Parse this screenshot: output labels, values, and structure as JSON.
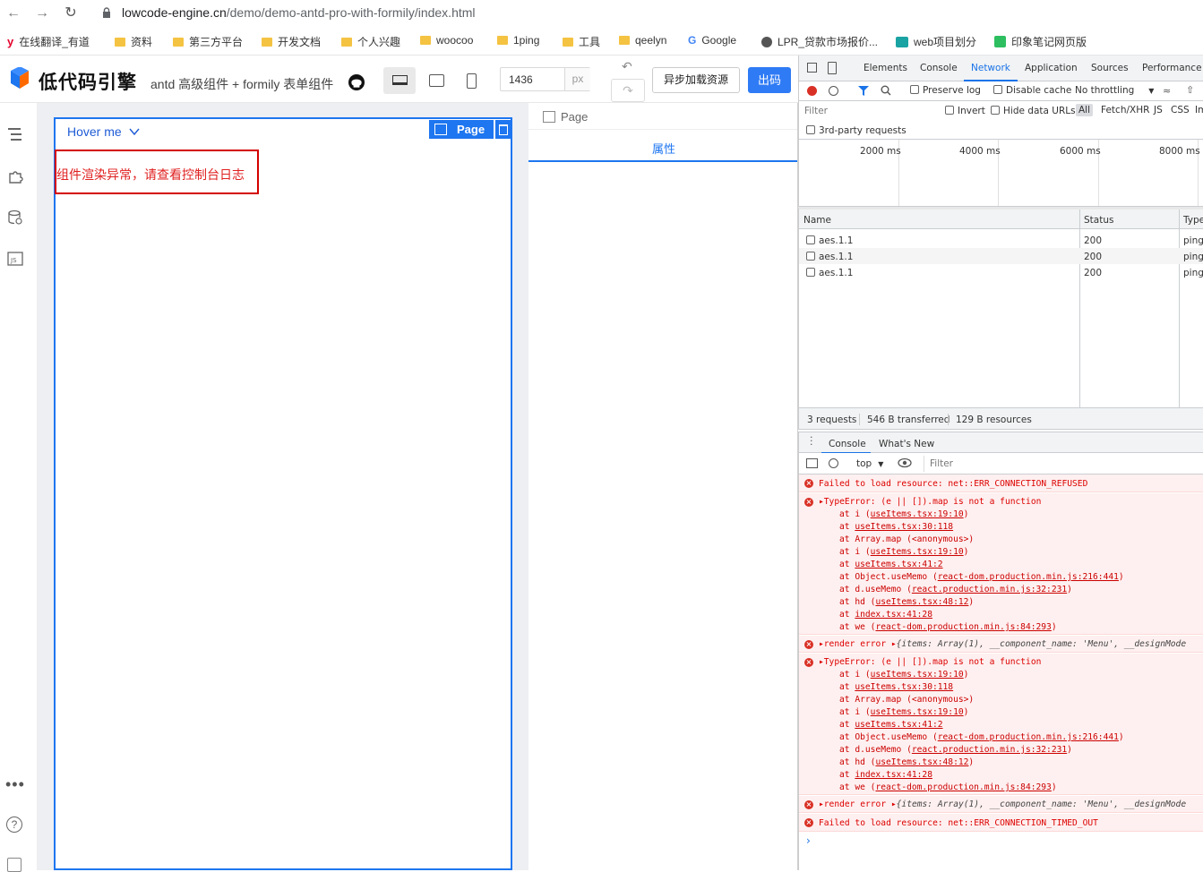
{
  "browser": {
    "url_host": "lowcode-engine.cn",
    "url_path": "/demo/demo-antd-pro-with-formily/index.html",
    "bookmarks": [
      {
        "label": "在线翻译_有道",
        "icon": "youdao-icon"
      },
      {
        "label": "资料",
        "icon": "folder-icon"
      },
      {
        "label": "第三方平台",
        "icon": "folder-icon"
      },
      {
        "label": "开发文档",
        "icon": "folder-icon"
      },
      {
        "label": "个人兴趣",
        "icon": "folder-icon"
      },
      {
        "label": "woocoo",
        "icon": "folder-icon"
      },
      {
        "label": "1ping",
        "icon": "folder-icon"
      },
      {
        "label": "工具",
        "icon": "folder-icon"
      },
      {
        "label": "qeelyn",
        "icon": "folder-icon"
      },
      {
        "label": "Google",
        "icon": "google-icon"
      },
      {
        "label": "LPR_贷款市场报价...",
        "icon": "globe-icon"
      },
      {
        "label": "web项目划分",
        "icon": "app-icon"
      },
      {
        "label": "印象笔记网页版",
        "icon": "evernote-icon"
      }
    ]
  },
  "app": {
    "logo_text": "低代码引擎",
    "subtitle": "antd 高级组件 + formily 表单组件",
    "width_value": "1436",
    "width_unit": "px",
    "async_load_label": "异步加载资源",
    "export_label": "出码",
    "hover_menu_label": "Hover me",
    "page_badge": "Page",
    "render_error": "组件渲染异常，请查看控制台日志",
    "settings_breadcrumb": "Page",
    "settings_tab": "属性"
  },
  "devtools": {
    "tabs": [
      "Elements",
      "Console",
      "Network",
      "Application",
      "Sources",
      "Performance"
    ],
    "active_tab": "Network",
    "preserve_log": "Preserve log",
    "disable_cache": "Disable cache",
    "throttling": "No throttling",
    "filter_placeholder": "Filter",
    "invert": "Invert",
    "hide_data_urls": "Hide data URLs",
    "type_filters": [
      "All",
      "Fetch/XHR",
      "JS",
      "CSS",
      "Im"
    ],
    "third_party": "3rd-party requests",
    "timeline_ticks": [
      "2000 ms",
      "4000 ms",
      "6000 ms",
      "8000 ms"
    ],
    "columns": [
      "Name",
      "Status",
      "Type"
    ],
    "requests": [
      {
        "name": "aes.1.1",
        "status": "200",
        "type": "ping"
      },
      {
        "name": "aes.1.1",
        "status": "200",
        "type": "ping"
      },
      {
        "name": "aes.1.1",
        "status": "200",
        "type": "ping"
      }
    ],
    "summary": {
      "requests": "3 requests",
      "transferred": "546 B transferred",
      "resources": "129 B resources"
    },
    "drawer_tabs": [
      "Console",
      "What's New"
    ],
    "context": "top",
    "console_filter": "Filter",
    "console": {
      "err1": "Failed to load resource: net::ERR_CONNECTION_REFUSED",
      "type_error": "TypeError: (e || []).map is not a function",
      "stack": [
        {
          "pre": "at i (",
          "link": "useItems.tsx:19:10",
          "post": ")"
        },
        {
          "pre": "at ",
          "link": "useItems.tsx:30:118",
          "post": ""
        },
        {
          "pre": "at Array.map (<anonymous>)",
          "link": "",
          "post": ""
        },
        {
          "pre": "at i (",
          "link": "useItems.tsx:19:10",
          "post": ")"
        },
        {
          "pre": "at ",
          "link": "useItems.tsx:41:2",
          "post": ""
        },
        {
          "pre": "at Object.useMemo (",
          "link": "react-dom.production.min.js:216:441",
          "post": ")"
        },
        {
          "pre": "at d.useMemo (",
          "link": "react.production.min.js:32:231",
          "post": ")"
        },
        {
          "pre": "at hd (",
          "link": "useItems.tsx:48:12",
          "post": ")"
        },
        {
          "pre": "at ",
          "link": "index.tsx:41:28",
          "post": ""
        },
        {
          "pre": "at we (",
          "link": "react-dom.production.min.js:84:293",
          "post": ")"
        }
      ],
      "render_error_prefix": "render error",
      "render_error_obj": "{items: Array(1), __component_name: 'Menu', __designMode",
      "err_last": "Failed to load resource: net::ERR_CONNECTION_TIMED_OUT"
    }
  }
}
